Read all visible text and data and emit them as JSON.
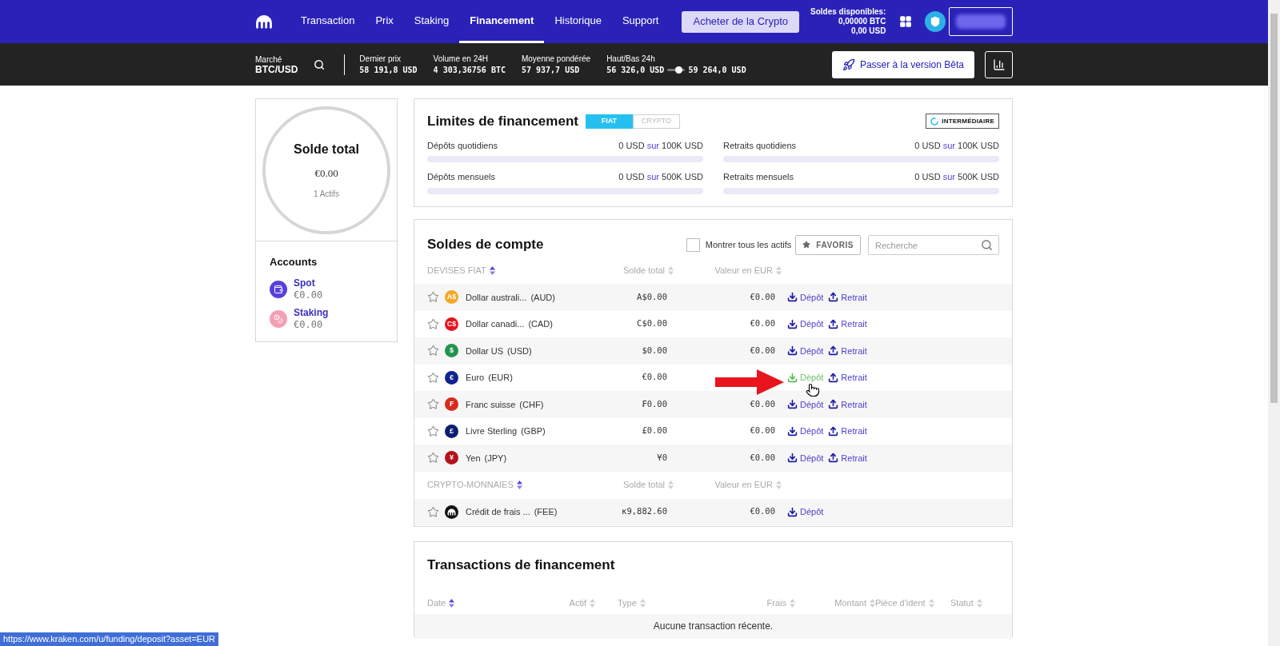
{
  "nav": {
    "items": [
      {
        "label": "Transaction",
        "selected": false
      },
      {
        "label": "Prix",
        "selected": false
      },
      {
        "label": "Staking",
        "selected": false
      },
      {
        "label": "Financement",
        "selected": true
      },
      {
        "label": "Historique",
        "selected": false
      },
      {
        "label": "Support",
        "selected": false
      }
    ],
    "buy_button": "Acheter de la Crypto",
    "balances": {
      "title": "Soldes disponibles:",
      "btc": "0,00000 BTC",
      "usd": "0,00 USD"
    }
  },
  "ticker": {
    "market": {
      "label": "Marché",
      "value": "BTC/USD"
    },
    "stats": [
      {
        "label": "Dernier prix",
        "value": "58 191,8",
        "unit": "USD"
      },
      {
        "label": "Volume en 24H",
        "value": "4 303,36756",
        "unit": "BTC"
      },
      {
        "label": "Moyenne pondérée",
        "value": "57 937,7",
        "unit": "USD"
      }
    ],
    "highlow": {
      "label": "Haut/Bas 24h",
      "low": "56 326,0",
      "low_unit": "USD",
      "high": "59 264,0",
      "high_unit": "USD",
      "level": 0.6
    },
    "beta_button": "Passer à la version Bêta"
  },
  "total": {
    "title": "Solde total",
    "amount": "€0.00",
    "assets": "1 Actifs"
  },
  "accounts": {
    "title": "Accounts",
    "items": [
      {
        "kind": "spot",
        "name": "Spot",
        "value": "€0.00",
        "color": "#5741d9"
      },
      {
        "kind": "staking",
        "name": "Staking",
        "value": "€0.00",
        "color": "#f59fb3"
      }
    ]
  },
  "limits": {
    "title": "Limites de financement",
    "tabs": [
      {
        "label": "FIAT",
        "selected": true
      },
      {
        "label": "CRYPTO",
        "selected": false
      }
    ],
    "tier": "INTERMÉDIAIRE",
    "rows": [
      {
        "label": "Dépôts quotidiens",
        "used": "0 USD",
        "sep": "sur",
        "max": "100K USD"
      },
      {
        "label": "Retraits quotidiens",
        "used": "0 USD",
        "sep": "sur",
        "max": "100K USD"
      },
      {
        "label": "Dépôts mensuels",
        "used": "0 USD",
        "sep": "sur",
        "max": "500K USD"
      },
      {
        "label": "Retraits mensuels",
        "used": "0 USD",
        "sep": "sur",
        "max": "500K USD"
      }
    ]
  },
  "balances": {
    "title": "Soldes de compte",
    "show_all": {
      "label": "Montrer tous les actifs",
      "checked": false
    },
    "favorites": "FAVORIS",
    "search": {
      "placeholder": "Recherche"
    },
    "sections": [
      {
        "columns": [
          {
            "label": "DEVISES FIAT",
            "sorted": true
          },
          {
            "label": "Solde total",
            "sorted": false
          },
          {
            "label": "Valeur en EUR",
            "sorted": false
          }
        ],
        "rows": [
          {
            "name": "Dollar australi...",
            "code": "(AUD)",
            "symbol": "A$",
            "color": "#f5a623",
            "total": "A$0.00",
            "eur": "€0.00",
            "actions": [
              {
                "kind": "deposit",
                "label": "Dépôt",
                "hovered": false
              },
              {
                "kind": "withdraw",
                "label": "Retrait",
                "hovered": false
              }
            ]
          },
          {
            "name": "Dollar canadi...",
            "code": "(CAD)",
            "symbol": "C$",
            "color": "#e8141e",
            "total": "C$0.00",
            "eur": "€0.00",
            "actions": [
              {
                "kind": "deposit",
                "label": "Dépôt",
                "hovered": false
              },
              {
                "kind": "withdraw",
                "label": "Retrait",
                "hovered": false
              }
            ]
          },
          {
            "name": "Dollar US",
            "code": "(USD)",
            "symbol": "$",
            "color": "#21944e",
            "total": "$0.00",
            "eur": "€0.00",
            "actions": [
              {
                "kind": "deposit",
                "label": "Dépôt",
                "hovered": false
              },
              {
                "kind": "withdraw",
                "label": "Retrait",
                "hovered": false
              }
            ]
          },
          {
            "name": "Euro",
            "code": "(EUR)",
            "symbol": "€",
            "color": "#10238f",
            "total": "€0.00",
            "actions": [
              {
                "kind": "deposit",
                "label": "Dépôt",
                "hovered": true
              },
              {
                "kind": "withdraw",
                "label": "Retrait",
                "hovered": false
              }
            ]
          },
          {
            "name": "Franc suisse",
            "code": "(CHF)",
            "symbol": "₣",
            "color": "#d92b1c",
            "total": "₣0.00",
            "eur": "€0.00",
            "actions": [
              {
                "kind": "deposit",
                "label": "Dépôt",
                "hovered": false
              },
              {
                "kind": "withdraw",
                "label": "Retrait",
                "hovered": false
              }
            ]
          },
          {
            "name": "Livre Sterling",
            "code": "(GBP)",
            "symbol": "£",
            "color": "#0c1d73",
            "total": "£0.00",
            "eur": "€0.00",
            "actions": [
              {
                "kind": "deposit",
                "label": "Dépôt",
                "hovered": false
              },
              {
                "kind": "withdraw",
                "label": "Retrait",
                "hovered": false
              }
            ]
          },
          {
            "name": "Yen",
            "code": "(JPY)",
            "symbol": "¥",
            "color": "#b5121b",
            "total": "¥0",
            "eur": "€0.00",
            "actions": [
              {
                "kind": "deposit",
                "label": "Dépôt",
                "hovered": false
              },
              {
                "kind": "withdraw",
                "label": "Retrait",
                "hovered": false
              }
            ]
          }
        ]
      },
      {
        "columns": [
          {
            "label": "CRYPTO-MONNAIES",
            "sorted": true
          },
          {
            "label": "Solde total",
            "sorted": false
          },
          {
            "label": "Valeur en EUR",
            "sorted": false
          }
        ],
        "rows": [
          {
            "name": "Crédit de frais ...",
            "code": "(FEE)",
            "color": "#111111",
            "total": "κ9,882.60",
            "eur": "€0.00",
            "actions": [
              {
                "kind": "deposit",
                "label": "Dépôt",
                "hovered": false
              }
            ]
          }
        ]
      }
    ]
  },
  "transactions": {
    "title": "Transactions de financement",
    "columns": [
      {
        "label": "Date",
        "sorted": true
      },
      {
        "label": "Actif",
        "sorted": false
      },
      {
        "label": "Type",
        "sorted": false
      },
      {
        "label": "Frais",
        "sorted": false
      },
      {
        "label": "Montant",
        "sorted": false
      },
      {
        "label": "Pièce d'ident",
        "sorted": false
      },
      {
        "label": "Statut",
        "sorted": false
      }
    ],
    "empty": "Aucune transaction récente."
  },
  "status_url": "https://www.kraken.com/u/funding/deposit?asset=EUR"
}
